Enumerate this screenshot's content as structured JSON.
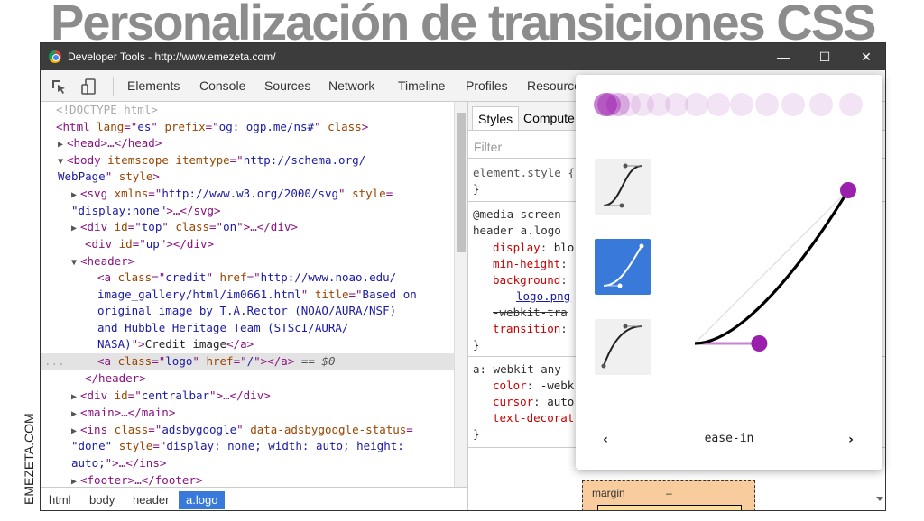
{
  "headline": "Personalización de transiciones CSS",
  "brand": "EMEZETA.COM",
  "window": {
    "title": "Developer Tools - http://www.emezeta.com/",
    "min": "—",
    "max": "☐",
    "close": "✕"
  },
  "tabs": [
    "Elements",
    "Console",
    "Sources",
    "Network",
    "Timeline",
    "Profiles",
    "Resource"
  ],
  "dom": {
    "doctype": "<!DOCTYPE html>",
    "html_open": [
      "<html ",
      "lang",
      "=\"",
      "es",
      "\" ",
      "prefix",
      "=\"",
      "og: ogp.me/ns#",
      "\" ",
      "class",
      ">"
    ],
    "head": "<head>…</head>",
    "body1": [
      "<body ",
      "itemscope ",
      "itemtype",
      "=\"",
      "http://schema.org/"
    ],
    "body2": [
      "WebPage",
      "\" ",
      "style",
      ">"
    ],
    "svg1": [
      "<svg ",
      "xmlns",
      "=\"",
      "http://www.w3.org/2000/svg",
      "\" ",
      "style",
      "="
    ],
    "svg2": [
      "\"display:none\"",
      ">…</svg>"
    ],
    "div_top": [
      "<div ",
      "id",
      "=\"",
      "top",
      "\" ",
      "class",
      "=\"",
      "on",
      "\">…</div>"
    ],
    "div_up": [
      "<div ",
      "id",
      "=\"",
      "up",
      "\"></div>"
    ],
    "header": "<header>",
    "a1": [
      "<a ",
      "class",
      "=\"",
      "credit",
      "\" ",
      "href",
      "=\"",
      "http://www.noao.edu/"
    ],
    "a2": [
      "image_gallery/html/im0661.html",
      "\" ",
      "title",
      "=\"",
      "Based on"
    ],
    "a3": "original image by T.A.Rector (NOAO/AURA/NSF)",
    "a4": "and Hubble Heritage Team (STScI/AURA/",
    "a5": [
      "NASA)",
      "\">",
      "Credit image",
      "</a>"
    ],
    "a_logo": [
      "<a ",
      "class",
      "=\"",
      "logo",
      "\" ",
      "href",
      "=\"",
      "/",
      "\"></a>",
      " == $0"
    ],
    "sel_dots": "...",
    "header_close": "</header>",
    "centralbar": [
      "<div ",
      "id",
      "=\"",
      "centralbar",
      "\">…</div>"
    ],
    "main": "<main>…</main>",
    "ins1": [
      "<ins ",
      "class",
      "=\"",
      "adsbygoogle",
      "\" ",
      "data-adsbygoogle-status",
      "="
    ],
    "ins2": [
      "\"done\" ",
      "style",
      "=\"",
      "display: none; width: auto; height:"
    ],
    "ins3": [
      "auto;",
      "\">…</ins>"
    ],
    "footer": "<footer>…</footer>"
  },
  "breadcrumbs": [
    "html",
    "body",
    "header",
    "a.logo"
  ],
  "styles": {
    "tabs": [
      "Styles",
      "Compute"
    ],
    "filter_placeholder": "Filter",
    "element_style": "element.style",
    "brace_open": " {",
    "brace_close": "}",
    "media": "@media screen",
    "selector": "header a.logo",
    "props": [
      {
        "name": "display",
        "value": " blo"
      },
      {
        "name": "min-height",
        "value": ""
      },
      {
        "name": "background",
        "value": ""
      },
      {
        "name": "",
        "value": "logo.png"
      },
      {
        "name": "-webkit-tra",
        "value": ""
      },
      {
        "name": "transition",
        "value": ""
      }
    ],
    "selector2": "a:-webkit-any-",
    "props2": [
      {
        "name": "color",
        "value": " -webk"
      },
      {
        "name": "cursor",
        "value": " auto"
      },
      {
        "name": "text-decorat",
        "value": ""
      }
    ],
    "boxmodel_label": "margin",
    "boxmodel_dash": "–"
  },
  "bezier": {
    "preset_label": "ease-in",
    "prev": "‹",
    "next": "›",
    "dots": 14,
    "accent": "#9b1fad",
    "selected_color": "#3879d9",
    "control_points": [
      0.42,
      0,
      1,
      1
    ]
  }
}
